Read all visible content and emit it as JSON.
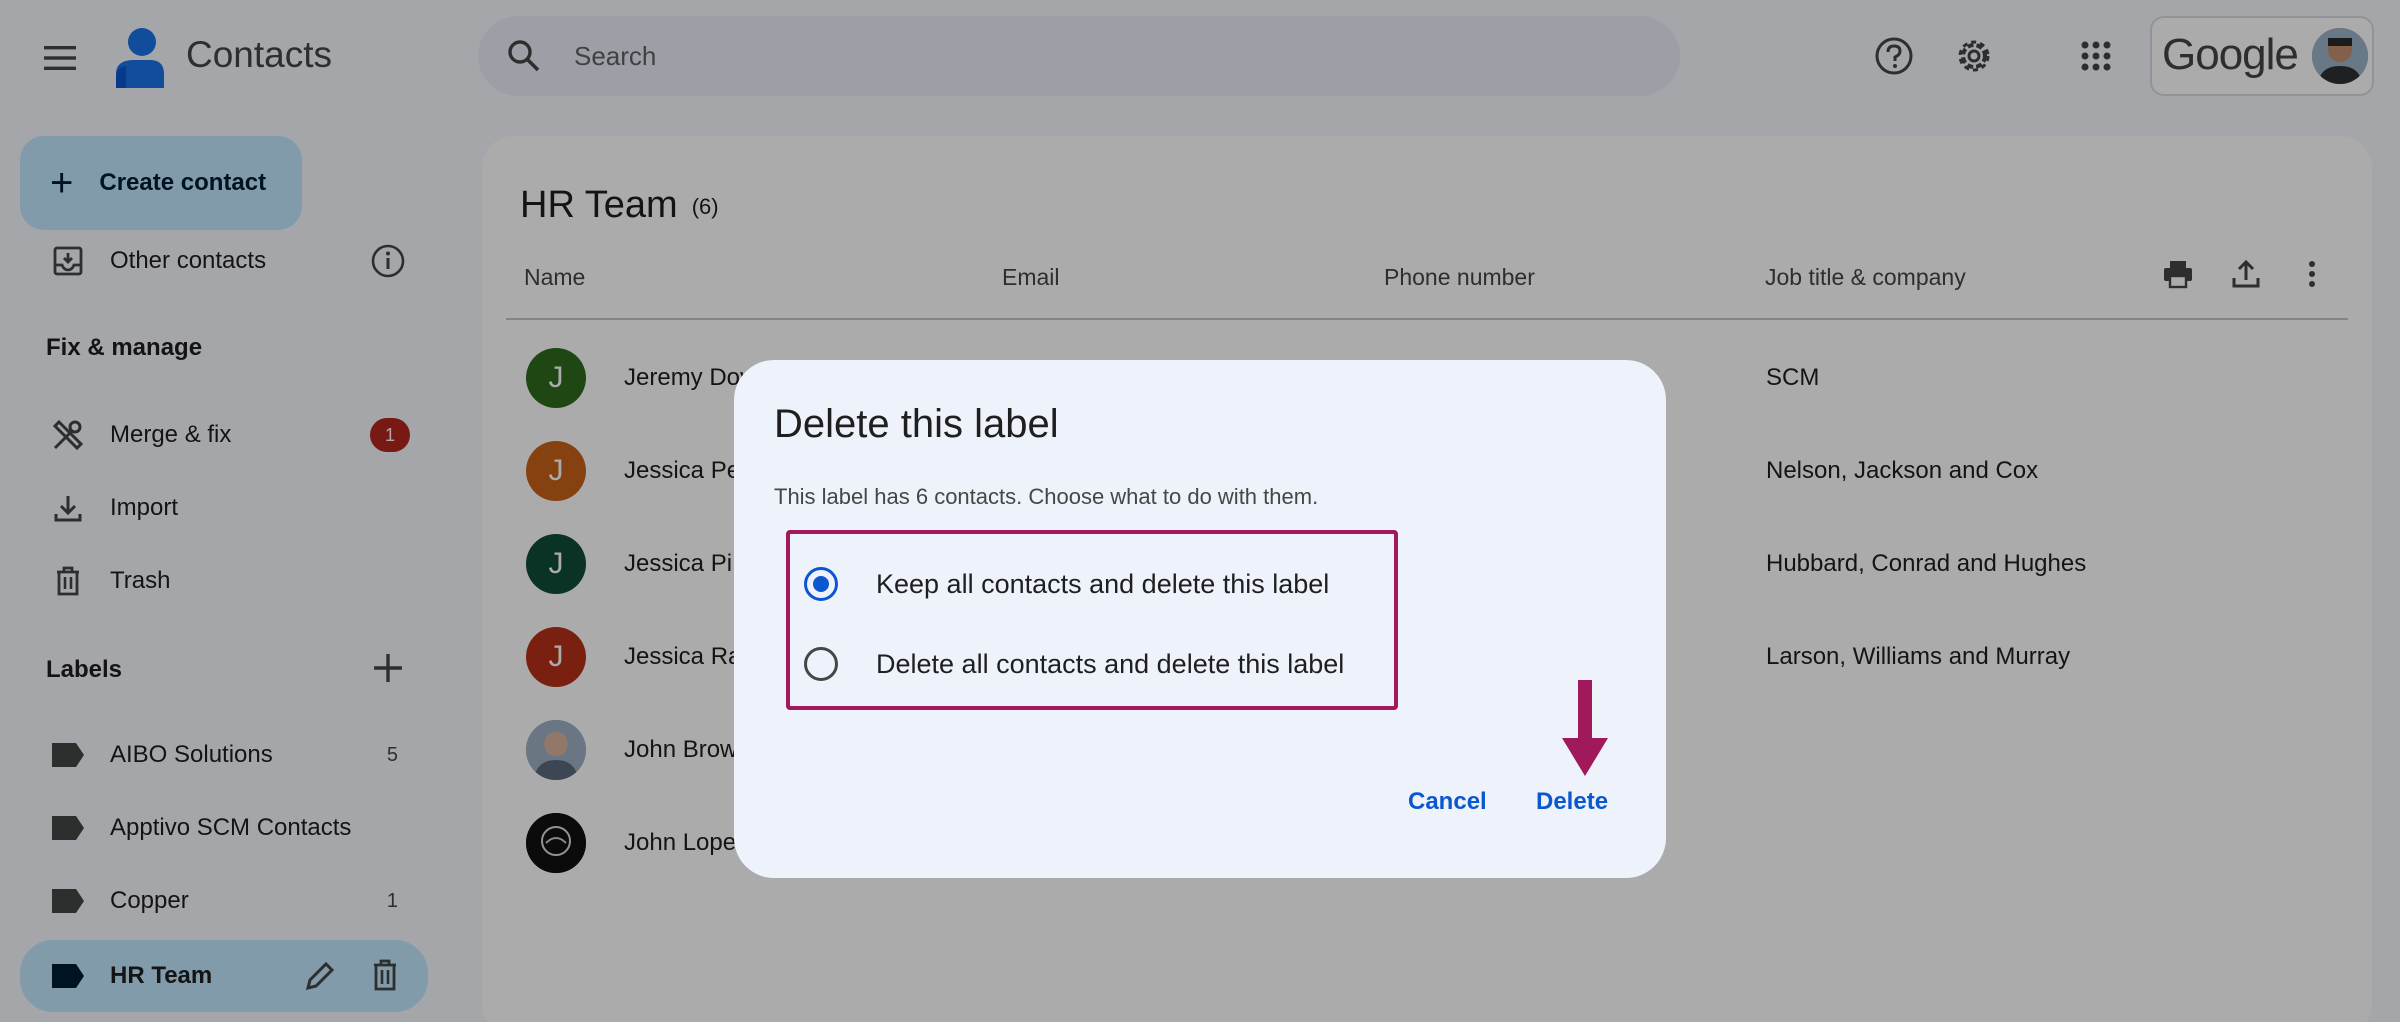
{
  "header": {
    "app_name": "Contacts",
    "search_placeholder": "Search",
    "brand": "Google"
  },
  "sidebar": {
    "create_label": "Create contact",
    "other_contacts": "Other contacts",
    "fix_manage_heading": "Fix & manage",
    "merge_fix": "Merge & fix",
    "merge_badge": "1",
    "import": "Import",
    "trash": "Trash",
    "labels_heading": "Labels",
    "labels": [
      {
        "name": "AIBO Solutions",
        "count": "5"
      },
      {
        "name": "Apptivo SCM Contacts",
        "count": ""
      },
      {
        "name": "Copper",
        "count": "1"
      },
      {
        "name": "HR Team",
        "count": ""
      }
    ]
  },
  "main": {
    "title": "HR Team",
    "count": "(6)",
    "columns": {
      "name": "Name",
      "email": "Email",
      "phone": "Phone number",
      "job": "Job title & company"
    },
    "rows": [
      {
        "initial": "J",
        "name": "Jeremy Dov",
        "job": "SCM",
        "color": "#2e6b1f"
      },
      {
        "initial": "J",
        "name": "Jessica Pe",
        "job": "Nelson, Jackson and Cox",
        "color": "#c8611a"
      },
      {
        "initial": "J",
        "name": "Jessica Pi",
        "job": "Hubbard, Conrad and Hughes",
        "color": "#0f4d38"
      },
      {
        "initial": "J",
        "name": "Jessica Ra",
        "job": "Larson, Williams and Murray",
        "color": "#b5301a"
      },
      {
        "initial": "",
        "name": "John Brow",
        "job": "",
        "color": "#8a9bb0"
      },
      {
        "initial": "",
        "name": "John Lope",
        "job": "",
        "color": "#111111"
      }
    ]
  },
  "dialog": {
    "title": "Delete this label",
    "subtitle": "This label has 6 contacts. Choose what to do with them.",
    "option_keep": "Keep all contacts and delete this label",
    "option_delete": "Delete all contacts and delete this label",
    "cancel": "Cancel",
    "delete": "Delete"
  },
  "colors": {
    "accent": "#0b57d0",
    "highlight": "#a0195b",
    "badge": "#b3261e"
  }
}
